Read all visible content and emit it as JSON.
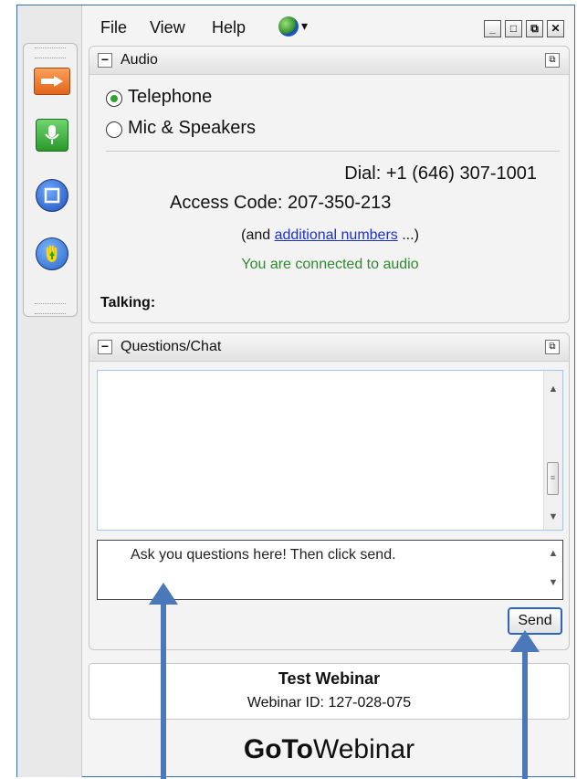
{
  "menu": {
    "file": "File",
    "view": "View",
    "help": "Help"
  },
  "audio": {
    "title": "Audio",
    "telephone": "Telephone",
    "mic_speakers": "Mic & Speakers",
    "dial": "Dial: +1 (646) 307-1001",
    "access_code": "Access Code: 207-350-213",
    "additional_prefix": "(and ",
    "additional_link": "additional numbers",
    "additional_suffix": " ...)",
    "status": "You are connected to audio",
    "talking": "Talking:"
  },
  "chat": {
    "title": "Questions/Chat",
    "input_placeholder": "Ask you questions here!  Then click send.",
    "send_label": "Send"
  },
  "webinar": {
    "title": "Test Webinar",
    "id": "Webinar ID: 127-028-075"
  },
  "brand": {
    "goto": "GoTo",
    "webinar": "Webinar"
  },
  "colors": {
    "accent": "#2d64c4",
    "status_green": "#2e8a2e",
    "annotation_arrow": "#4a78b8"
  }
}
